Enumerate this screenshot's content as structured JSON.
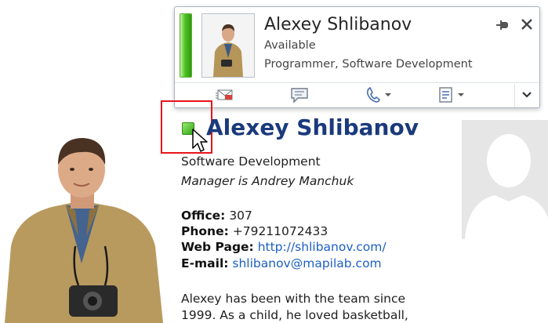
{
  "card": {
    "name": "Alexey Shlibanov",
    "status": "Available",
    "title": "Programmer, Software Development",
    "presence_color": "#3fb61b",
    "actions": [
      {
        "icon": "email-icon"
      },
      {
        "icon": "instant-message-icon"
      },
      {
        "icon": "phone-icon",
        "dropdown": true
      },
      {
        "icon": "contact-details-icon",
        "dropdown": true
      }
    ]
  },
  "profile": {
    "name": "Alexey Shlibanov",
    "department": "Software Development",
    "manager": "Manager is Andrey Manchuk",
    "office_label": "Office:",
    "office": "307",
    "phone_label": "Phone:",
    "phone": "+79211072433",
    "web_label": "Web Page:",
    "web": "http://shlibanov.com/",
    "email_label": "E-mail:",
    "email": "shlibanov@mapilab.com",
    "bio_line1": "Alexey has been with the team since",
    "bio_line2": "1999. As a child, he loved basketball,",
    "name_color": "#1a3a7c",
    "link_color": "#1c5fc4",
    "highlight_color": "#e8141b"
  }
}
